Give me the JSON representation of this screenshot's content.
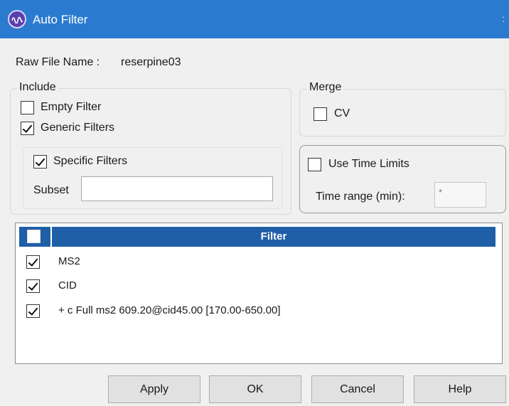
{
  "window": {
    "title": "Auto Filter",
    "edge_glyph": ":"
  },
  "raw_file": {
    "label": "Raw File Name :",
    "value": "reserpine03"
  },
  "include": {
    "legend": "Include",
    "empty_filter": {
      "label": "Empty Filter",
      "checked": false
    },
    "generic_filters": {
      "label": "Generic Filters",
      "checked": true
    },
    "specific_filters": {
      "label": "Specific Filters",
      "checked": true
    },
    "subset": {
      "label": "Subset",
      "value": ""
    }
  },
  "merge": {
    "legend": "Merge",
    "cv": {
      "label": "CV",
      "checked": false
    }
  },
  "time_limits": {
    "use_label": "Use Time Limits",
    "checked": false,
    "range_label": "Time range (min):",
    "range_value": "*"
  },
  "filter_list": {
    "header": "Filter",
    "select_all_checked": false,
    "rows": [
      {
        "label": "MS2",
        "checked": true
      },
      {
        "label": "CID",
        "checked": true
      },
      {
        "label": "+ c Full ms2 609.20@cid45.00 [170.00-650.00]",
        "checked": true
      }
    ]
  },
  "buttons": {
    "apply": "Apply",
    "ok": "OK",
    "cancel": "Cancel",
    "help": "Help"
  },
  "colors": {
    "titlebar": "#2a7bd0",
    "list_header": "#1f5fa8",
    "dialog_bg": "#f0f0f0"
  }
}
